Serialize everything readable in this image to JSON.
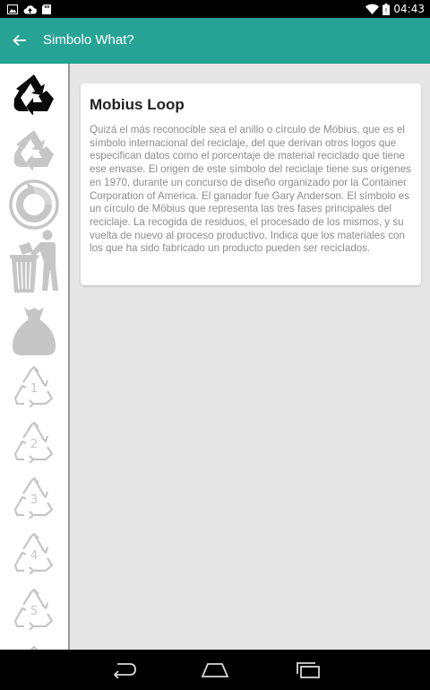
{
  "status_bar": {
    "time": "04:43",
    "icons": [
      "image-icon",
      "cloud-upload-icon",
      "sd-card-icon",
      "wifi-icon",
      "battery-icon"
    ]
  },
  "app_bar": {
    "title": "Simbolo What?",
    "back_icon": "arrow-back-icon",
    "color": "#27a396"
  },
  "sidebar": {
    "items": [
      {
        "icon": "recycle-symbol-icon",
        "style": "black"
      },
      {
        "icon": "recycle-logo-icon",
        "style": "gray"
      },
      {
        "icon": "green-dot-icon",
        "style": "gray"
      },
      {
        "icon": "tidyman-icon",
        "style": "gray"
      },
      {
        "icon": "garbage-bag-icon",
        "style": "gray"
      },
      {
        "icon": "plastic-code-1-icon",
        "number": "1"
      },
      {
        "icon": "plastic-code-2-icon",
        "number": "2"
      },
      {
        "icon": "plastic-code-3-icon",
        "number": "3"
      },
      {
        "icon": "plastic-code-4-icon",
        "number": "4"
      },
      {
        "icon": "plastic-code-5-icon",
        "number": "5"
      }
    ]
  },
  "card": {
    "title": "Mobius Loop",
    "text": "Quizá el más reconocible sea el anillo o círculo de Möbius, que es el símbolo internacional del reciclaje, del que derivan otros logos que especifican datos como el porcentaje de material reciclado que tiene ese envase. El origen de este símbolo del reciclaje tiene sus orígenes en 1970, durante un concurso de diseño organizado por la Container Corporation of America. El ganador fue Gary Anderson. El símbolo es un círculo de Möbius que representa las tres fases principales del reciclaje. La recogida de residuos, el procesado de los mismos, y su vuelta de nuevo al proceso productivo. Indica que los materiales con los que ha sido fabricado un producto pueden ser reciclados."
  },
  "nav_bar": {
    "buttons": [
      "back-nav-icon",
      "home-nav-icon",
      "recents-nav-icon"
    ]
  }
}
